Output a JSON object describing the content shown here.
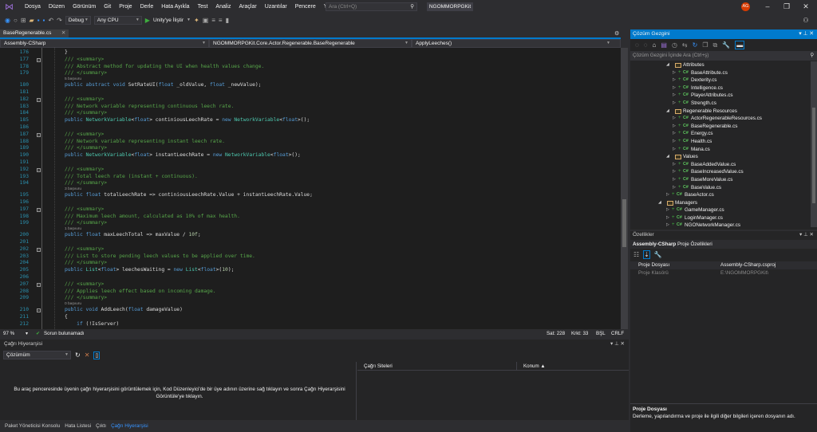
{
  "menubar": {
    "items": [
      "Dosya",
      "Düzen",
      "Görünüm",
      "Git",
      "Proje",
      "Derle",
      "Hata Ayıkla",
      "Test",
      "Analiz",
      "Araçlar",
      "Uzantılar",
      "Pencere",
      "Yardım"
    ],
    "search_placeholder": "Ara (Ctrl+Q)",
    "solution_title": "NGOMMORPGKit",
    "avatar_initials": "AG"
  },
  "toolbar": {
    "configuration": "Debug",
    "platform": "Any CPU",
    "attach_label": "Unity'ye İliştir"
  },
  "editor": {
    "tab_label": "BaseRegenerable.cs",
    "nav_project": "Assembly-CSharp",
    "nav_class": "NGOMMORPGKit.Core.Actor.Regenerable.BaseRegenerable",
    "nav_member": "ApplyLeeches()",
    "lines": [
      {
        "n": "176",
        "s": [
          [
            "p",
            "}"
          ]
        ]
      },
      {
        "n": "177",
        "f": true,
        "s": [
          [
            "c",
            "/// <summary>"
          ]
        ]
      },
      {
        "n": "178",
        "s": [
          [
            "c",
            "/// Abstract method for updating the UI when health values change."
          ]
        ]
      },
      {
        "n": "179",
        "s": [
          [
            "c",
            "/// </summary>"
          ]
        ]
      },
      {
        "lens": "5 başvuru"
      },
      {
        "n": "180",
        "s": [
          [
            "k",
            "public "
          ],
          [
            "k",
            "abstract "
          ],
          [
            "k",
            "void "
          ],
          [
            "p",
            "SetRateUI("
          ],
          [
            "k",
            "float "
          ],
          [
            "p",
            "_oldValue, "
          ],
          [
            "k",
            "float "
          ],
          [
            "p",
            "_newValue);"
          ]
        ]
      },
      {
        "n": "181",
        "s": []
      },
      {
        "n": "182",
        "f": true,
        "s": [
          [
            "c",
            "/// <summary>"
          ]
        ]
      },
      {
        "n": "183",
        "s": [
          [
            "c",
            "/// Network variable representing continuous leech rate."
          ]
        ]
      },
      {
        "n": "184",
        "s": [
          [
            "c",
            "/// </summary>"
          ]
        ]
      },
      {
        "n": "185",
        "s": [
          [
            "k",
            "public "
          ],
          [
            "t",
            "NetworkVariable"
          ],
          [
            "p",
            "<"
          ],
          [
            "k",
            "float"
          ],
          [
            "p",
            "> continiousLeechRate = "
          ],
          [
            "k",
            "new "
          ],
          [
            "t",
            "NetworkVariable"
          ],
          [
            "p",
            "<"
          ],
          [
            "k",
            "float"
          ],
          [
            "p",
            ">();"
          ]
        ]
      },
      {
        "n": "186",
        "s": []
      },
      {
        "n": "187",
        "f": true,
        "s": [
          [
            "c",
            "/// <summary>"
          ]
        ]
      },
      {
        "n": "188",
        "s": [
          [
            "c",
            "/// Network variable representing instant leech rate."
          ]
        ]
      },
      {
        "n": "189",
        "s": [
          [
            "c",
            "/// </summary>"
          ]
        ]
      },
      {
        "n": "190",
        "s": [
          [
            "k",
            "public "
          ],
          [
            "t",
            "NetworkVariable"
          ],
          [
            "p",
            "<"
          ],
          [
            "k",
            "float"
          ],
          [
            "p",
            "> instantLeechRate = "
          ],
          [
            "k",
            "new "
          ],
          [
            "t",
            "NetworkVariable"
          ],
          [
            "p",
            "<"
          ],
          [
            "k",
            "float"
          ],
          [
            "p",
            ">();"
          ]
        ]
      },
      {
        "n": "191",
        "s": []
      },
      {
        "n": "192",
        "f": true,
        "s": [
          [
            "c",
            "/// <summary>"
          ]
        ]
      },
      {
        "n": "193",
        "s": [
          [
            "c",
            "/// Total leech rate (instant + continuous)."
          ]
        ]
      },
      {
        "n": "194",
        "s": [
          [
            "c",
            "/// </summary>"
          ]
        ]
      },
      {
        "lens": "3 başvuru"
      },
      {
        "n": "195",
        "s": [
          [
            "k",
            "public "
          ],
          [
            "k",
            "float "
          ],
          [
            "p",
            "totalLeechRate => continiousLeechRate.Value + instantLeechRate.Value;"
          ]
        ]
      },
      {
        "n": "196",
        "s": []
      },
      {
        "n": "197",
        "f": true,
        "s": [
          [
            "c",
            "/// <summary>"
          ]
        ]
      },
      {
        "n": "198",
        "s": [
          [
            "c",
            "/// Maximum leech amount, calculated as 10% of max health."
          ]
        ]
      },
      {
        "n": "199",
        "s": [
          [
            "c",
            "/// </summary>"
          ]
        ]
      },
      {
        "lens": "1 başvuru"
      },
      {
        "n": "200",
        "s": [
          [
            "k",
            "public "
          ],
          [
            "k",
            "float "
          ],
          [
            "p",
            "maxLeechTotal => maxValue / "
          ],
          [
            "n",
            "10f"
          ],
          [
            "p",
            ";"
          ]
        ]
      },
      {
        "n": "201",
        "s": []
      },
      {
        "n": "202",
        "f": true,
        "s": [
          [
            "c",
            "/// <summary>"
          ]
        ]
      },
      {
        "n": "203",
        "s": [
          [
            "c",
            "/// List to store pending leech values to be applied over time."
          ]
        ]
      },
      {
        "n": "204",
        "s": [
          [
            "c",
            "/// </summary>"
          ]
        ]
      },
      {
        "n": "205",
        "s": [
          [
            "k",
            "public "
          ],
          [
            "t",
            "List"
          ],
          [
            "p",
            "<"
          ],
          [
            "k",
            "float"
          ],
          [
            "p",
            "> leechesWaiting = "
          ],
          [
            "k",
            "new "
          ],
          [
            "t",
            "List"
          ],
          [
            "p",
            "<"
          ],
          [
            "k",
            "float"
          ],
          [
            "p",
            ">("
          ],
          [
            "n",
            "10"
          ],
          [
            "p",
            ");"
          ]
        ]
      },
      {
        "n": "206",
        "s": []
      },
      {
        "n": "207",
        "f": true,
        "s": [
          [
            "c",
            "/// <summary>"
          ]
        ]
      },
      {
        "n": "208",
        "s": [
          [
            "c",
            "/// Applies leech effect based on incoming damage."
          ]
        ]
      },
      {
        "n": "209",
        "s": [
          [
            "c",
            "/// </summary>"
          ]
        ]
      },
      {
        "lens": "0 başvuru"
      },
      {
        "n": "210",
        "f": true,
        "s": [
          [
            "k",
            "public "
          ],
          [
            "k",
            "void "
          ],
          [
            "p",
            "AddLeech("
          ],
          [
            "k",
            "float "
          ],
          [
            "p",
            "damageValue)"
          ]
        ]
      },
      {
        "n": "211",
        "s": [
          [
            "p",
            "{"
          ]
        ]
      },
      {
        "n": "212",
        "s": [
          [
            "p",
            "    "
          ],
          [
            "k",
            "if "
          ],
          [
            "p",
            "(!IsServer)"
          ]
        ]
      }
    ]
  },
  "status": {
    "zoom": "97 %",
    "issues": "Sorun bulunamadı",
    "line": "Sat: 228",
    "col": "Krkt: 33",
    "mode": "BŞL",
    "eol": "CRLF"
  },
  "call_hierarchy": {
    "title": "Çağrı Hiyerarşisi",
    "scope": "Çözümüm",
    "col_sites": "Çağrı Siteleri",
    "col_location": "Konum",
    "hint": "Bu araç penceresinde üyenin çağrı hiyerarşisini görüntülemek için, Kod Düzenleyici'de bir üye adının üzerine sağ tıklayın ve sonra Çağrı Hiyerarşisini Görüntüle'ye tıklayın."
  },
  "bottom_tabs": [
    "Paket Yöneticisi Konsolu",
    "Hata Listesi",
    "Çıktı",
    "Çağrı Hiyerarşisi"
  ],
  "solution_explorer": {
    "title": "Çözüm Gezgini",
    "search_placeholder": "Çözüm Gezgini İçinde Ara (Ctrl+ş)",
    "items": [
      {
        "label": "Attributes",
        "type": "folder",
        "depth": 2
      },
      {
        "label": "BaseAttribute.cs",
        "type": "cs",
        "depth": 3
      },
      {
        "label": "Dexterity.cs",
        "type": "cs",
        "depth": 3
      },
      {
        "label": "Intelligence.cs",
        "type": "cs",
        "depth": 3
      },
      {
        "label": "PlayerAttributes.cs",
        "type": "cs",
        "depth": 3
      },
      {
        "label": "Strength.cs",
        "type": "cs",
        "depth": 3
      },
      {
        "label": "Regenerable Resources",
        "type": "folder",
        "depth": 2
      },
      {
        "label": "ActorRegenerableResources.cs",
        "type": "cs",
        "depth": 3
      },
      {
        "label": "BaseRegenerable.cs",
        "type": "cs",
        "depth": 3
      },
      {
        "label": "Energy.cs",
        "type": "cs",
        "depth": 3
      },
      {
        "label": "Health.cs",
        "type": "cs",
        "depth": 3
      },
      {
        "label": "Mana.cs",
        "type": "cs",
        "depth": 3
      },
      {
        "label": "Values",
        "type": "folder",
        "depth": 2
      },
      {
        "label": "BaseAddedValue.cs",
        "type": "cs",
        "depth": 3
      },
      {
        "label": "BaseIncreasedValue.cs",
        "type": "cs",
        "depth": 3
      },
      {
        "label": "BaseMoreValue.cs",
        "type": "cs",
        "depth": 3
      },
      {
        "label": "BaseValue.cs",
        "type": "cs",
        "depth": 3
      },
      {
        "label": "BaseActor.cs",
        "type": "cs",
        "depth": 2
      },
      {
        "label": "Managers",
        "type": "folder",
        "depth": 1
      },
      {
        "label": "GameManager.cs",
        "type": "cs",
        "depth": 2
      },
      {
        "label": "LoginManager.cs",
        "type": "cs",
        "depth": 2
      },
      {
        "label": "NGONetworkManager.cs",
        "type": "cs",
        "depth": 2
      }
    ]
  },
  "properties": {
    "title": "Özellikler",
    "object_name": "Assembly-CSharp",
    "object_type": "Proje Özellikleri",
    "rows": [
      {
        "name": "Proje Dosyası",
        "value": "Assembly-CSharp.csproj"
      },
      {
        "name": "Proje Klasörü",
        "value": "E:\\NGOMMORPGKit\\"
      }
    ],
    "desc_title": "Proje Dosyası",
    "desc_text": "Derleme, yapılandırma ve proje ile ilgili diğer bilgileri içeren dosyanın adı."
  },
  "colors": {
    "accent": "#007acc",
    "editor_bg": "#1e1e1e",
    "keyword": "#569cd6",
    "type": "#4ec9b0",
    "comment": "#57a64a"
  }
}
